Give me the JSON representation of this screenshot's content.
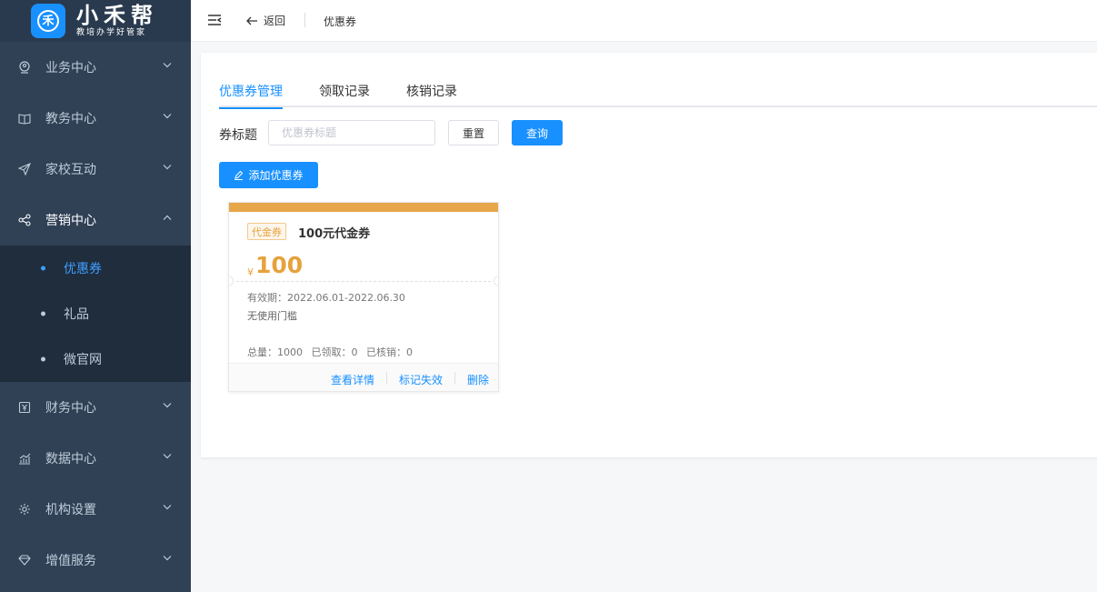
{
  "brand": {
    "name": "小禾帮",
    "slogan": "教培办学好管家",
    "logo_char": "禾"
  },
  "sidebar": {
    "items": [
      {
        "label": "业务中心",
        "icon": "business-icon"
      },
      {
        "label": "教务中心",
        "icon": "book-icon"
      },
      {
        "label": "家校互动",
        "icon": "paper-plane-icon"
      },
      {
        "label": "营销中心",
        "icon": "share-icon",
        "open": true,
        "children": [
          {
            "label": "优惠券",
            "active": true
          },
          {
            "label": "礼品"
          },
          {
            "label": "微官网"
          }
        ]
      },
      {
        "label": "财务中心",
        "icon": "finance-icon"
      },
      {
        "label": "数据中心",
        "icon": "chart-icon"
      },
      {
        "label": "机构设置",
        "icon": "gear-icon"
      },
      {
        "label": "增值服务",
        "icon": "diamond-icon"
      }
    ]
  },
  "header": {
    "back_label": "返回",
    "title": "优惠券"
  },
  "tabs": [
    {
      "label": "优惠券管理",
      "active": true
    },
    {
      "label": "领取记录"
    },
    {
      "label": "核销记录"
    }
  ],
  "filter": {
    "label": "券标题",
    "placeholder": "优惠券标题",
    "value": "",
    "reset_label": "重置",
    "query_label": "查询"
  },
  "add_button_label": "添加优惠券",
  "coupon": {
    "tag": "代金券",
    "title": "100元代金券",
    "currency": "¥",
    "amount": "100",
    "validity": "有效期：2022.06.01-2022.06.30",
    "threshold": "无使用门槛",
    "stats": {
      "total": "总量：1000",
      "received": "已领取：0",
      "redeemed": "已核销：0"
    },
    "actions": {
      "detail": "查看详情",
      "invalidate": "标记失效",
      "delete": "删除"
    },
    "accent_color": "#e7a64a"
  },
  "colors": {
    "primary": "#1890ff",
    "sidebar_bg": "#304156",
    "submenu_bg": "#1f2d3d"
  }
}
